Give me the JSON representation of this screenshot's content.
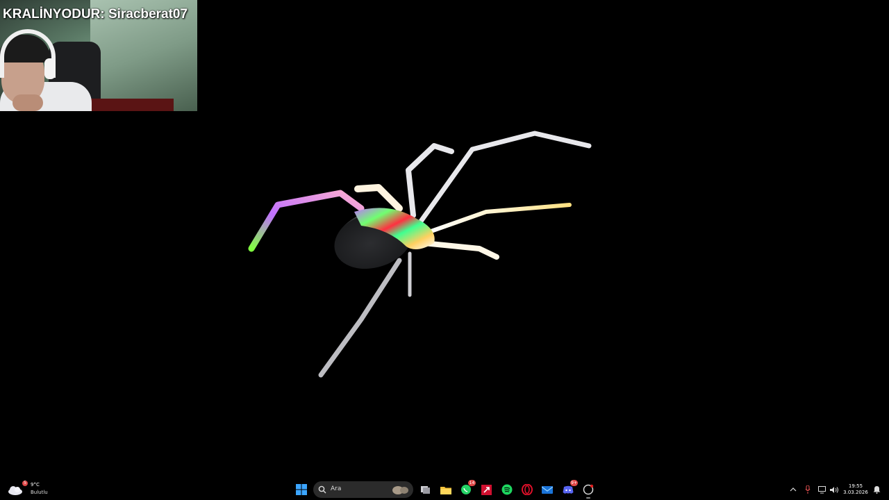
{
  "overlay": {
    "text": "KRALİNYODUR: Siracberat07"
  },
  "taskbar": {
    "weather": {
      "temperature": "9°C",
      "description": "Bulutlu",
      "badge": "5"
    },
    "search": {
      "placeholder": "Ara"
    },
    "apps": [
      {
        "name": "start",
        "badge": ""
      },
      {
        "name": "task-view",
        "badge": ""
      },
      {
        "name": "file-explorer",
        "badge": ""
      },
      {
        "name": "whatsapp",
        "badge": "14"
      },
      {
        "name": "app-red-square",
        "badge": ""
      },
      {
        "name": "spotify",
        "badge": ""
      },
      {
        "name": "opera",
        "badge": ""
      },
      {
        "name": "mail",
        "badge": ""
      },
      {
        "name": "discord",
        "badge": "9+"
      },
      {
        "name": "app-active",
        "badge": ""
      }
    ],
    "clock": {
      "time": "19:55",
      "date": "3.03.2026"
    }
  },
  "colors": {
    "taskbar_bg": "#000000",
    "search_bg": "#2b2b2b",
    "badge": "#e04848"
  }
}
